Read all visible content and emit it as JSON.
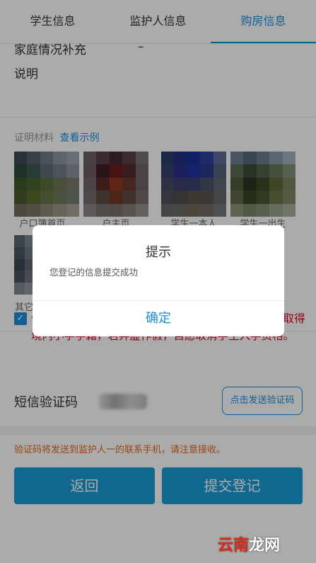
{
  "tabs": [
    {
      "label": "学生信息"
    },
    {
      "label": "监护人信息"
    },
    {
      "label": "购房信息"
    }
  ],
  "form": {
    "cut_field_label": "家庭情况补充",
    "cut_field_value": "–",
    "remark_label": "说明"
  },
  "materials": {
    "title": "证明材料",
    "example_link": "查看示例",
    "items": [
      {
        "label": "户口簿首页"
      },
      {
        "label": "户主页"
      },
      {
        "label": "学生一本人"
      },
      {
        "label": "学生一出生"
      },
      {
        "label": "其它"
      }
    ]
  },
  "agreement": {
    "checked": true,
    "text": "信用保证：本人保证所提交信息真实无误。孩子未曾取得境内小学学籍，若弄虚作假，自愿取消学生入学资格。"
  },
  "sms": {
    "label": "短信验证码",
    "send_button": "点击发送验证码",
    "note": "验证码将发送到监护人一的联系手机，请注意接收。"
  },
  "actions": {
    "back": "返回",
    "submit": "提交登记"
  },
  "dialog": {
    "title": "提示",
    "message": "您登记的信息提交成功",
    "confirm": "确定"
  },
  "watermark": {
    "part1": "云南",
    "part2": "龙网"
  },
  "colors": {
    "accent": "#1a8fd8",
    "warning_red": "#d9001b",
    "note_orange": "#e06a1b",
    "button_blue": "#1a9bd6"
  }
}
